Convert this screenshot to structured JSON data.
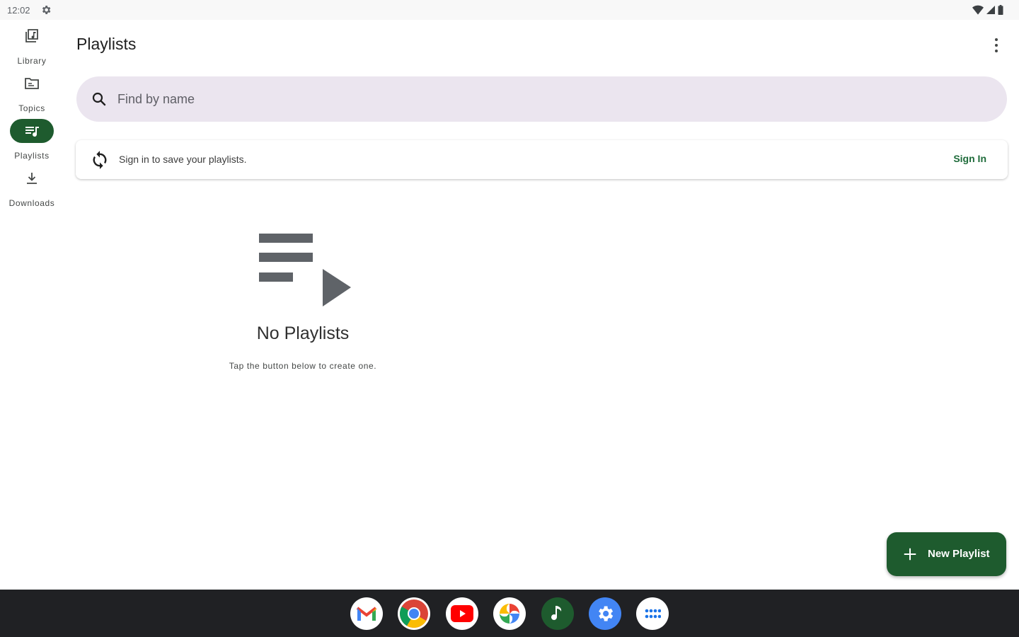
{
  "status_bar": {
    "time": "12:02",
    "settings_icon": "gear-icon",
    "wifi_icon": "wifi-icon",
    "signal_icon": "signal-icon",
    "battery_icon": "battery-icon"
  },
  "nav_rail": {
    "items": [
      {
        "label": "Library",
        "icon": "library-icon",
        "active": false
      },
      {
        "label": "Topics",
        "icon": "folder-icon",
        "active": false
      },
      {
        "label": "Playlists",
        "icon": "playlist-icon",
        "active": true
      },
      {
        "label": "Downloads",
        "icon": "download-icon",
        "active": false
      }
    ]
  },
  "app_bar": {
    "title": "Playlists",
    "menu_icon": "more-vert-icon"
  },
  "search": {
    "placeholder": "Find by name",
    "value": ""
  },
  "signin_card": {
    "message": "Sign in to save your playlists.",
    "action_label": "Sign In"
  },
  "empty_state": {
    "title": "No Playlists",
    "subtitle": "Tap the button below to create one."
  },
  "fab": {
    "label": "New Playlist",
    "icon": "plus-icon"
  },
  "dock": {
    "apps": [
      "gmail-icon",
      "chrome-icon",
      "youtube-icon",
      "photos-icon",
      "music-app-icon",
      "settings-app-icon",
      "app-launcher-icon"
    ]
  },
  "colors": {
    "accent": "#1e5b2e",
    "search_bg": "#ebe5ef",
    "taskbar_bg": "#202124",
    "link": "#1e6b3a"
  }
}
